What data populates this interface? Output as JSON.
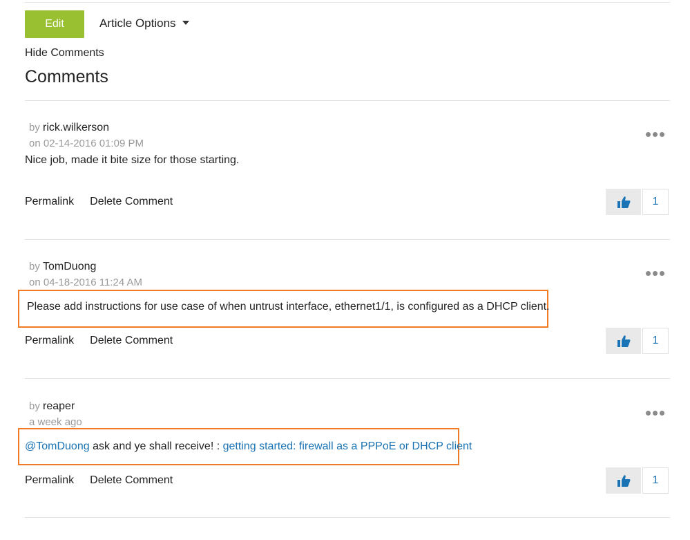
{
  "toolbar": {
    "edit_label": "Edit",
    "options_label": "Article Options",
    "hide_comments": "Hide Comments"
  },
  "section": {
    "title": "Comments"
  },
  "colors": {
    "edit_green": "#99c031",
    "link_blue": "#1a73b5",
    "highlight_orange": "#f07b24"
  },
  "comments": [
    {
      "by": "by",
      "author": "rick.wilkerson",
      "date": "on 02-14-2016 01:09 PM",
      "body_text": "Nice job, made it bite size for those starting.",
      "permalink": "Permalink",
      "delete": "Delete Comment",
      "kudos": "1"
    },
    {
      "by": "by",
      "author": "TomDuong",
      "date": "on 04-18-2016 11:24 AM",
      "body_text": "Please add instructions for use case of when untrust interface, ethernet1/1, is configured as a DHCP client.",
      "permalink": "Permalink",
      "delete": "Delete Comment",
      "kudos": "1"
    },
    {
      "by": "by",
      "author": "reaper",
      "date": "a week ago",
      "mention": "@TomDuong",
      "body_mid": " ask and ye shall receive! : ",
      "link_text": "getting started: firewall as a PPPoE or DHCP client",
      "permalink": "Permalink",
      "delete": "Delete Comment",
      "kudos": "1"
    }
  ]
}
